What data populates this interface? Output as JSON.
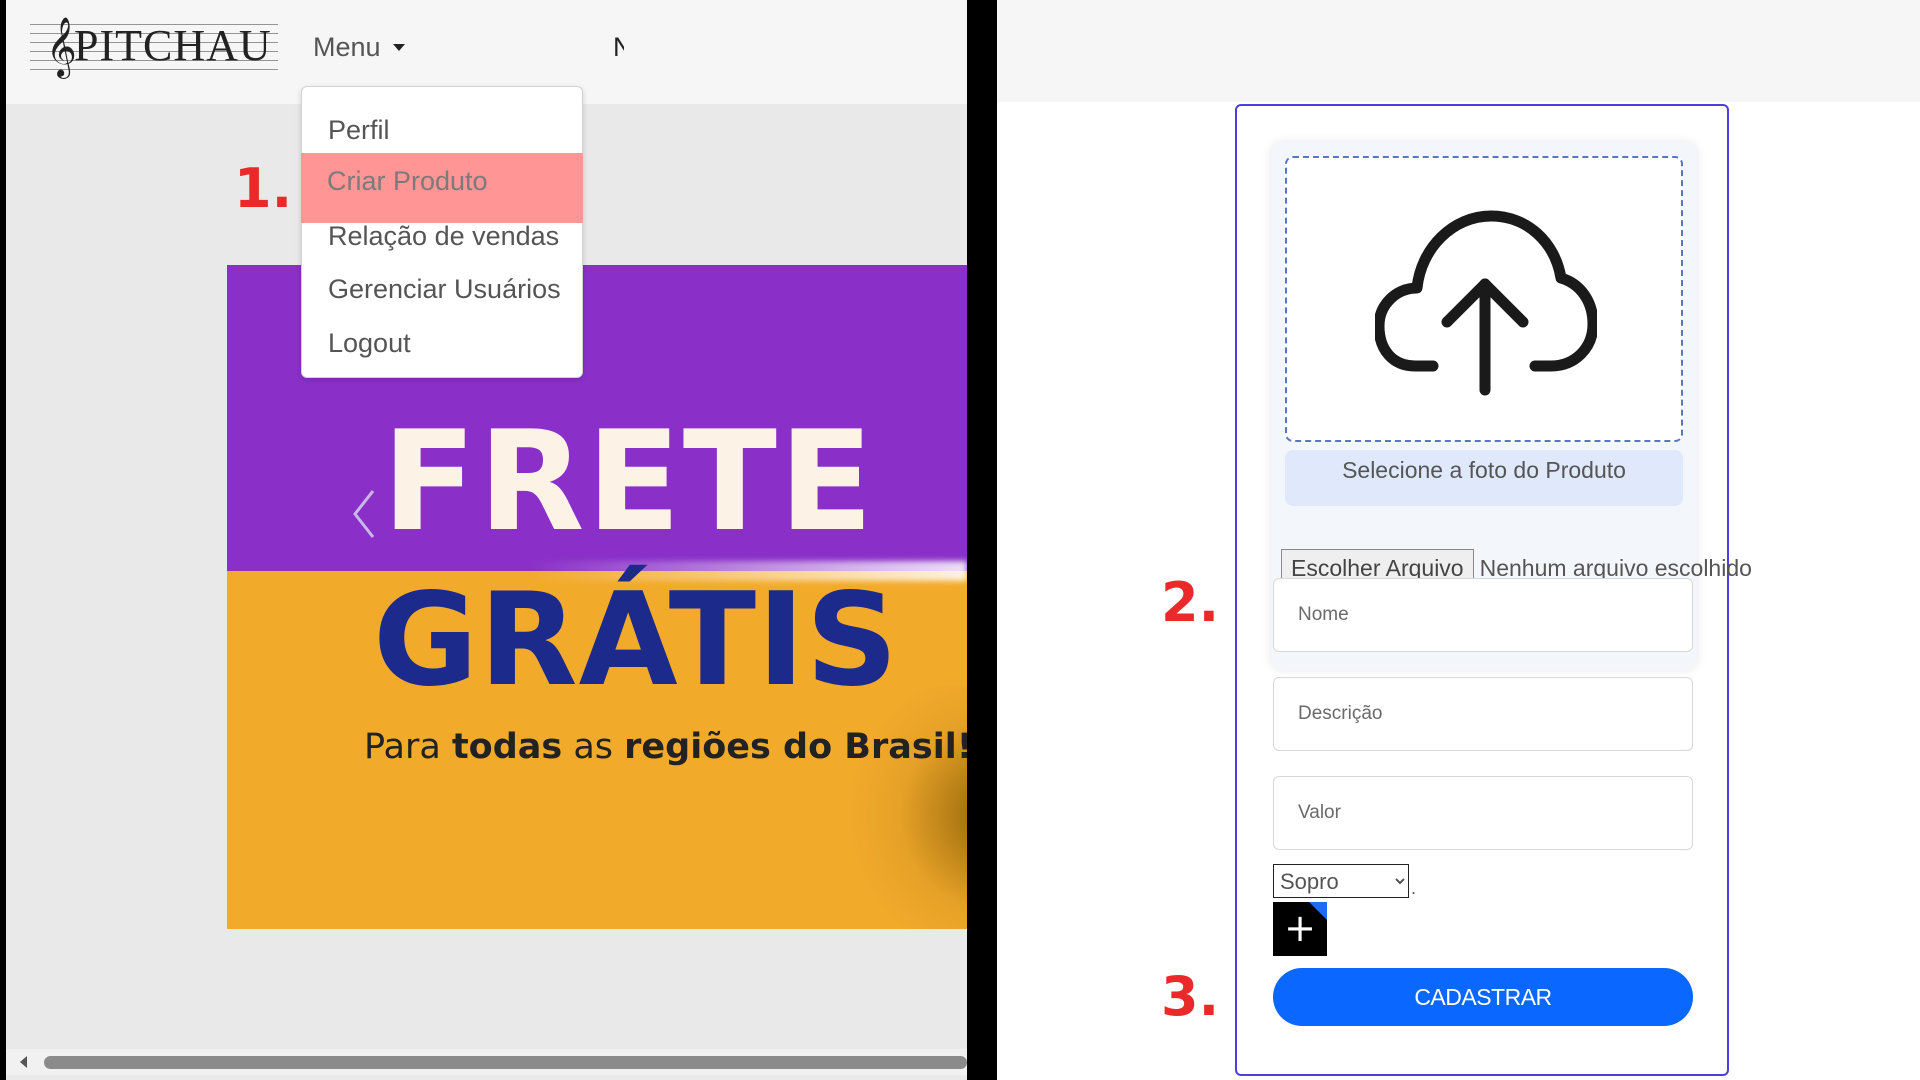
{
  "brand": {
    "name": "PITCHAU",
    "clef_glyph": "𝄞"
  },
  "navbar": {
    "menu_label": "Menu",
    "next_item_partial": "N"
  },
  "dropdown": {
    "items": [
      {
        "label": "Perfil",
        "highlighted": false
      },
      {
        "label": "Criar Produto",
        "highlighted": true
      },
      {
        "label": "Relação de vendas",
        "highlighted": false
      },
      {
        "label": "Gerenciar Usuários",
        "highlighted": false
      },
      {
        "label": "Logout",
        "highlighted": false
      }
    ],
    "highlight_color": "#ff9595"
  },
  "banner": {
    "line1": "FRETE",
    "line2": "GRÁTIS",
    "tagline_part1": "Para ",
    "tagline_bold1": "todas",
    "tagline_part2": " as ",
    "tagline_bold2": "regiões do Brasil!",
    "colors": {
      "top": "#8a30c8",
      "bottom": "#f2aa2b",
      "line1": "#fdf2e6",
      "line2": "#1c2a8c"
    }
  },
  "steps": {
    "one": "1.",
    "two": "2.",
    "three": "3.",
    "color": "#ea2a2a"
  },
  "product_form": {
    "upload_icon": "cloud-upload-icon",
    "upload_label": "Selecione a foto do Produto",
    "file_button": "Escolher Arquivo",
    "file_status": "Nenhum arquivo escolhido",
    "name_placeholder": "Nome",
    "description_placeholder": "Descrição",
    "value_placeholder": "Valor",
    "category_selected": "Sopro",
    "add_button": "+",
    "submit_label": "CADASTRAR",
    "accent_color": "#0a67ff",
    "border_color": "#4c3ee0"
  }
}
